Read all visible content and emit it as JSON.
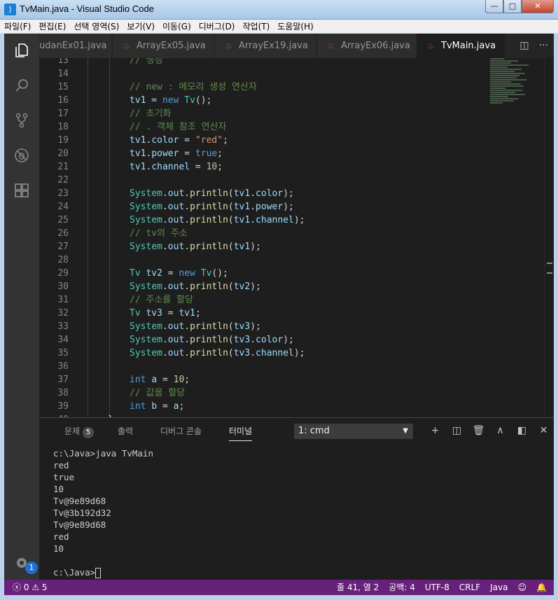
{
  "window": {
    "title": "TvMain.java - Visual Studio Code"
  },
  "menu": [
    "파일(F)",
    "편집(E)",
    "선택 영역(S)",
    "보기(V)",
    "이동(G)",
    "디버그(D)",
    "작업(T)",
    "도움말(H)"
  ],
  "tabs": [
    {
      "label": "udanEx01.java",
      "active": false
    },
    {
      "label": "ArrayEx05.java",
      "active": false
    },
    {
      "label": "ArrayEx19.java",
      "active": false
    },
    {
      "label": "ArrayEx06.java",
      "active": false
    },
    {
      "label": "TvMain.java",
      "active": true
    }
  ],
  "tab_close_glyph": "✕",
  "tab_more_glyph": "···",
  "code": {
    "lines": [
      {
        "n": "13",
        "text": "// 생성"
      },
      {
        "n": "14",
        "text": ""
      },
      {
        "n": "15",
        "text": "// new : 메모리 생성 연산자"
      },
      {
        "n": "16",
        "text": "tv1 = new Tv();"
      },
      {
        "n": "17",
        "text": "// 초기화"
      },
      {
        "n": "18",
        "text": "// . 객체 참조 연산자"
      },
      {
        "n": "19",
        "text": "tv1.color = \"red\";"
      },
      {
        "n": "20",
        "text": "tv1.power = true;"
      },
      {
        "n": "21",
        "text": "tv1.channel = 10;"
      },
      {
        "n": "22",
        "text": ""
      },
      {
        "n": "23",
        "text": "System.out.println(tv1.color);"
      },
      {
        "n": "24",
        "text": "System.out.println(tv1.power);"
      },
      {
        "n": "25",
        "text": "System.out.println(tv1.channel);"
      },
      {
        "n": "26",
        "text": "// tv의 주소"
      },
      {
        "n": "27",
        "text": "System.out.println(tv1);"
      },
      {
        "n": "28",
        "text": ""
      },
      {
        "n": "29",
        "text": "Tv tv2 = new Tv();"
      },
      {
        "n": "30",
        "text": "System.out.println(tv2);"
      },
      {
        "n": "31",
        "text": "// 주소를 할당"
      },
      {
        "n": "32",
        "text": "Tv tv3 = tv1;"
      },
      {
        "n": "33",
        "text": "System.out.println(tv3);"
      },
      {
        "n": "34",
        "text": "System.out.println(tv3.color);"
      },
      {
        "n": "35",
        "text": "System.out.println(tv3.channel);"
      },
      {
        "n": "36",
        "text": ""
      },
      {
        "n": "37",
        "text": "int a = 10;"
      },
      {
        "n": "38",
        "text": "// 값을 할당"
      },
      {
        "n": "39",
        "text": "int b = a;"
      },
      {
        "n": "40",
        "text": "}"
      }
    ]
  },
  "panel": {
    "tabs": [
      {
        "label": "문제",
        "badge": "5",
        "active": false
      },
      {
        "label": "출력",
        "active": false
      },
      {
        "label": "디버그 콘솔",
        "active": false
      },
      {
        "label": "터미널",
        "active": true
      }
    ],
    "terminal_select": "1: cmd",
    "terminal_lines": [
      "c:\\Java>java TvMain",
      "red",
      "true",
      "10",
      "Tv@9e89d68",
      "Tv@3b192d32",
      "Tv@9e89d68",
      "red",
      "10",
      "",
      "c:\\Java>"
    ]
  },
  "activity": {
    "badge": "1"
  },
  "status": {
    "errors": "0",
    "warnings": "5",
    "position": "줄 41, 열 2",
    "spaces": "공백: 4",
    "encoding": "UTF-8",
    "eol": "CRLF",
    "language": "Java"
  },
  "colors": {
    "statusbar": "#68217a",
    "editor_bg": "#1e1e1e",
    "activity_bg": "#333333"
  }
}
